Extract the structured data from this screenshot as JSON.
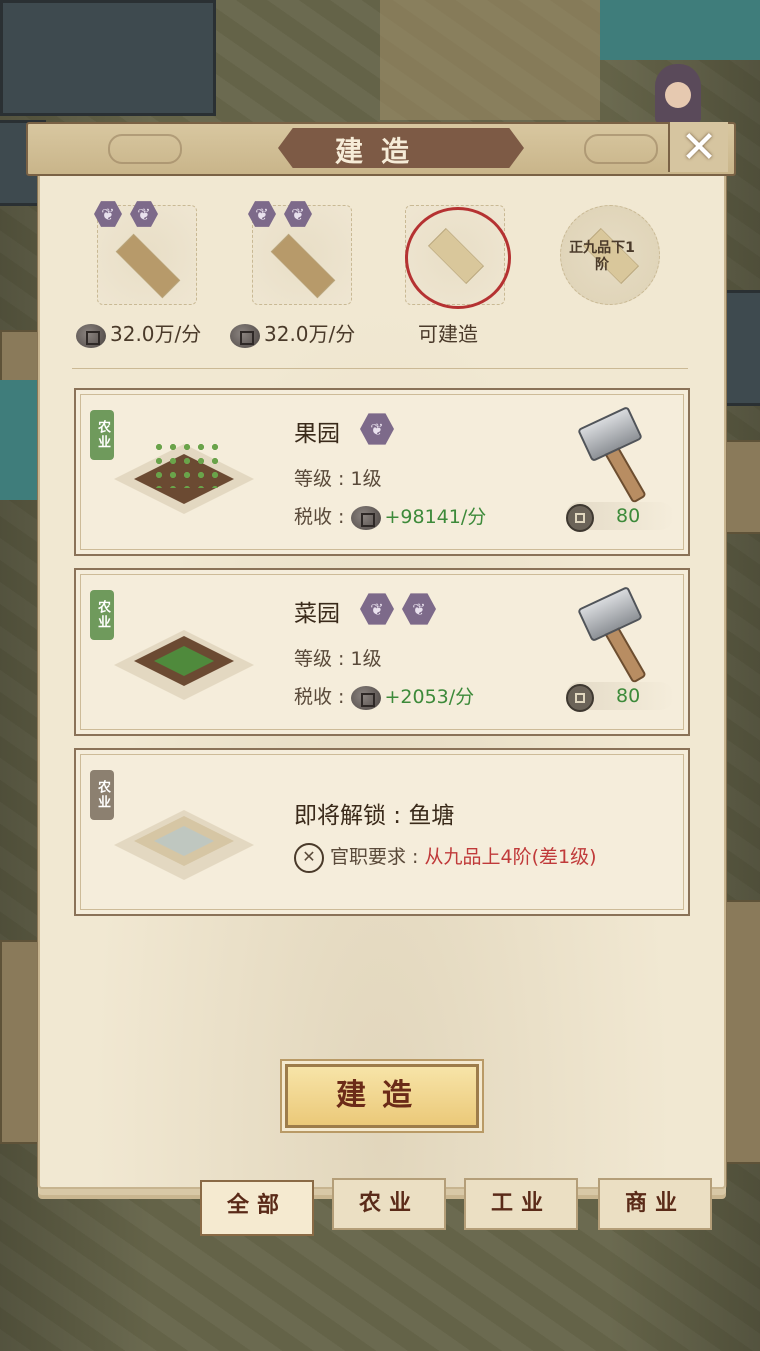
{
  "header": {
    "title": "建造"
  },
  "queue": [
    {
      "badges": [
        "crop-icon",
        "crop-icon"
      ],
      "rate": "32.0万/分"
    },
    {
      "badges": [
        "crop-icon",
        "crop-icon"
      ],
      "rate": "32.0万/分"
    },
    {
      "status": "可建造"
    },
    {
      "rank": "正九品下1阶"
    }
  ],
  "buildings": [
    {
      "tag": "农业",
      "name": "果园",
      "level_label": "等级",
      "level": "1级",
      "tax_label": "税收",
      "tax": "+98141/分",
      "cost": "80"
    },
    {
      "tag": "农业",
      "name": "菜园",
      "level_label": "等级",
      "level": "1级",
      "tax_label": "税收",
      "tax": "+2053/分",
      "cost": "80"
    }
  ],
  "locked": {
    "tag": "农业",
    "title": "即将解锁 : 鱼塘",
    "req_label": "官职要求 :",
    "req_value": "从九品上4阶(差1级)"
  },
  "build_button": "建造",
  "tabs": [
    "全部",
    "农业",
    "工业",
    "商业"
  ],
  "colors": {
    "tax_green": "#3d8a3a",
    "req_red": "#c03a3a",
    "accent_brown": "#7d5a45"
  }
}
